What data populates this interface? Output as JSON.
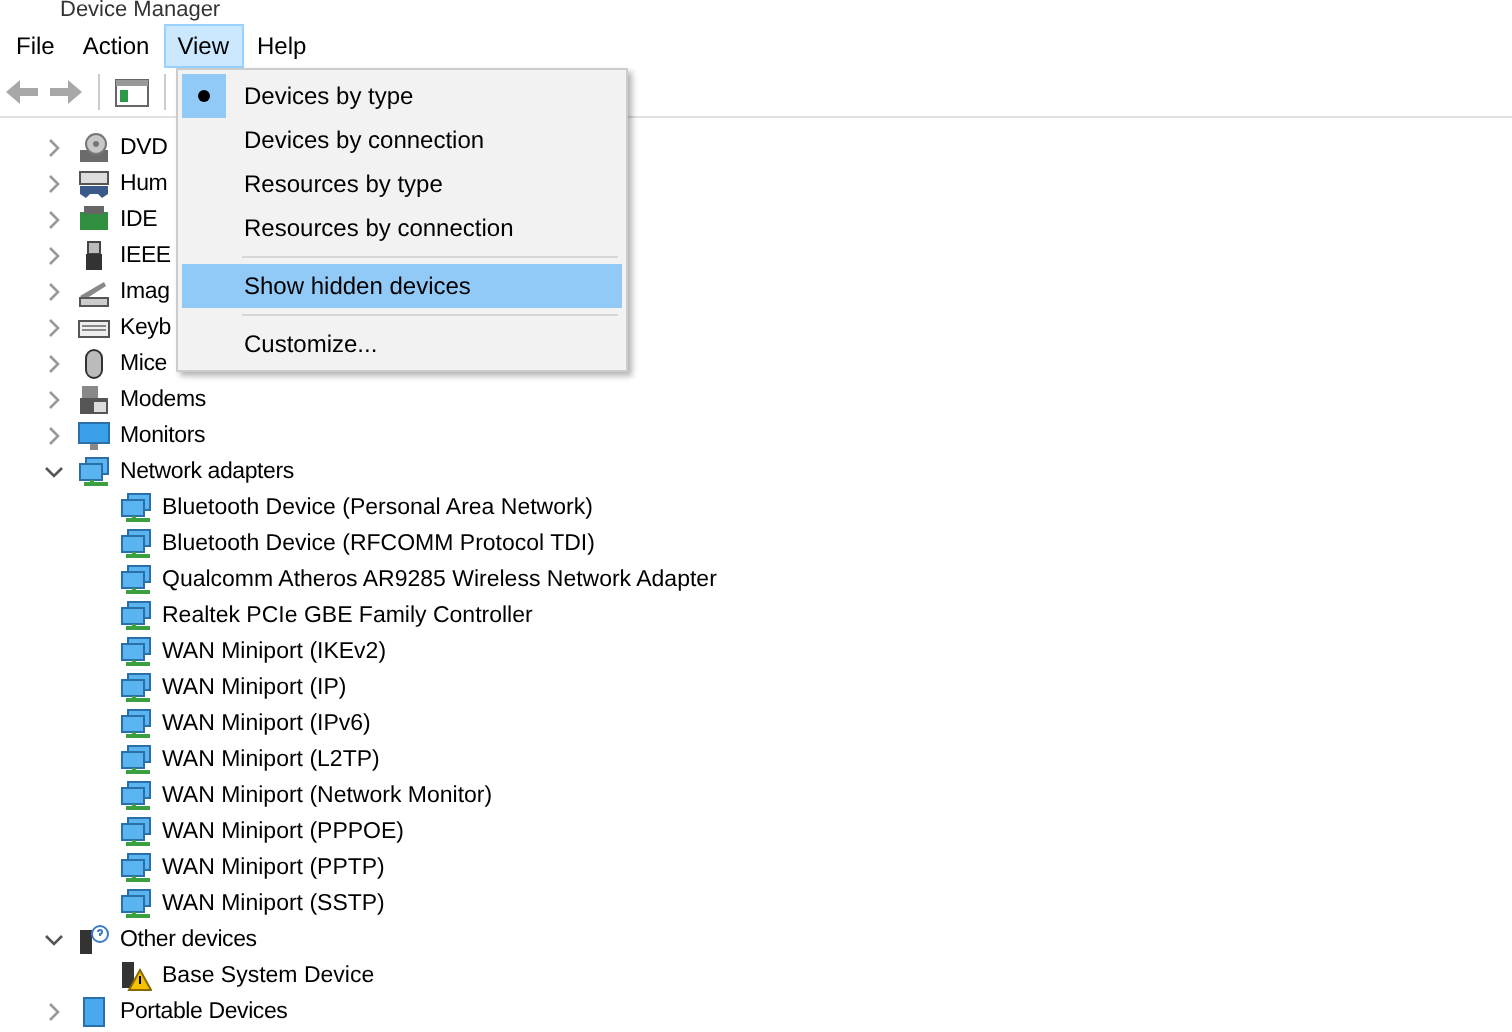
{
  "window": {
    "title": "Device Manager"
  },
  "menu_bar": [
    {
      "label": "File",
      "selected": false
    },
    {
      "label": "Action",
      "selected": false
    },
    {
      "label": "View",
      "selected": true
    },
    {
      "label": "Help",
      "selected": false
    }
  ],
  "view_menu": [
    {
      "kind": "radio",
      "label": "Devices by type",
      "selected": true,
      "highlighted": false
    },
    {
      "kind": "radio",
      "label": "Devices by connection",
      "selected": false,
      "highlighted": false
    },
    {
      "kind": "radio",
      "label": "Resources by type",
      "selected": false,
      "highlighted": false
    },
    {
      "kind": "radio",
      "label": "Resources by connection",
      "selected": false,
      "highlighted": false
    },
    {
      "kind": "separator"
    },
    {
      "kind": "command",
      "label": "Show hidden devices",
      "highlighted": true
    },
    {
      "kind": "separator"
    },
    {
      "kind": "command",
      "label": "Customize...",
      "highlighted": false
    }
  ],
  "tree": [
    {
      "label": "DVD",
      "expanded": false
    },
    {
      "label": "Hum",
      "expanded": false
    },
    {
      "label": "IDE",
      "expanded": false
    },
    {
      "label": "IEEE",
      "expanded": false
    },
    {
      "label": "Imag",
      "expanded": false
    },
    {
      "label": "Keyb",
      "expanded": false
    },
    {
      "label": "Mice",
      "expanded": false
    },
    {
      "label": "Modems",
      "expanded": false
    },
    {
      "label": "Monitors",
      "expanded": false
    },
    {
      "label": "Network adapters",
      "expanded": true,
      "children": [
        {
          "label": "Bluetooth Device (Personal Area Network)"
        },
        {
          "label": "Bluetooth Device (RFCOMM Protocol TDI)"
        },
        {
          "label": "Qualcomm Atheros AR9285 Wireless Network Adapter"
        },
        {
          "label": "Realtek PCIe GBE Family Controller"
        },
        {
          "label": "WAN Miniport (IKEv2)"
        },
        {
          "label": "WAN Miniport (IP)"
        },
        {
          "label": "WAN Miniport (IPv6)"
        },
        {
          "label": "WAN Miniport (L2TP)"
        },
        {
          "label": "WAN Miniport (Network Monitor)"
        },
        {
          "label": "WAN Miniport (PPPOE)"
        },
        {
          "label": "WAN Miniport (PPTP)"
        },
        {
          "label": "WAN Miniport (SSTP)"
        }
      ]
    },
    {
      "label": "Other devices",
      "expanded": true,
      "children": [
        {
          "label": "Base System Device"
        }
      ]
    },
    {
      "label": "Portable Devices",
      "expanded": false
    }
  ]
}
